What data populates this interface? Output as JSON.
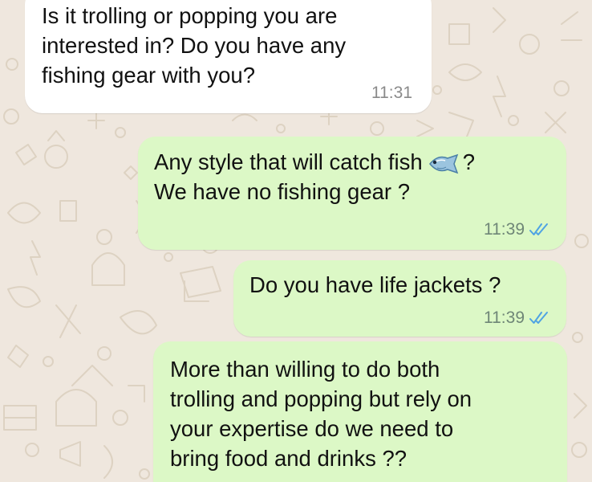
{
  "chat": {
    "messages": [
      {
        "direction": "incoming",
        "lines": [
          "Is it trolling or popping you are",
          "interested in? Do you have any",
          "fishing gear with you?"
        ],
        "time": "11:31"
      },
      {
        "direction": "outgoing",
        "line1_text": "Any style that will catch fish",
        "line1_emoji": "fish-emoji",
        "line1_suffix": "?",
        "line2": "We have no fishing gear ?",
        "time": "11:39",
        "status_icon": "double-check-read-icon"
      },
      {
        "direction": "outgoing",
        "lines": [
          "Do you have life jackets ?"
        ],
        "time": "11:39",
        "status_icon": "double-check-read-icon"
      },
      {
        "direction": "outgoing",
        "lines": [
          "More than willing to do both",
          "trolling and popping but rely on",
          "your expertise do we need to",
          "bring food and drinks ??"
        ]
      }
    ]
  },
  "colors": {
    "wallpaper": "#efe7de",
    "incoming_bubble": "#ffffff",
    "outgoing_bubble": "#dcf8c6",
    "read_ticks": "#4fa3e3"
  }
}
